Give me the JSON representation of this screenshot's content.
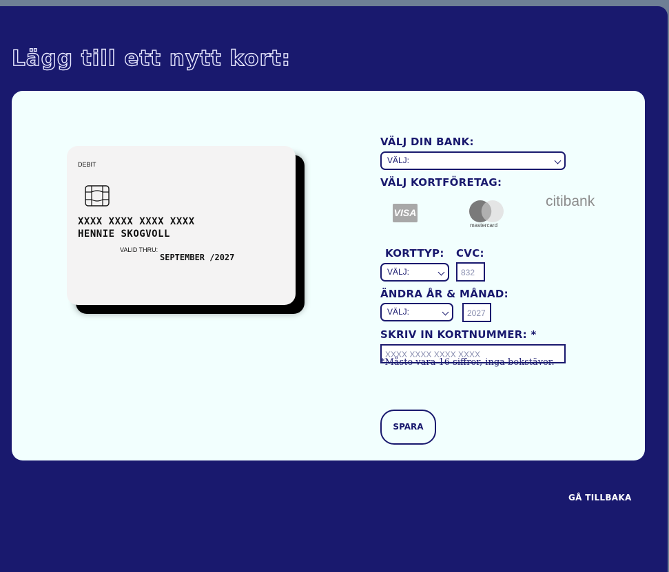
{
  "page": {
    "title": "Lägg till ett nytt kort:"
  },
  "card": {
    "type": "DEBIT",
    "number": "XXXX XXXX XXXX XXXX",
    "holder": "HENNIE SKOGVOLL",
    "valid_label": "VALID THRU:",
    "valid_date": "SEPTEMBER /2027"
  },
  "form": {
    "bank_label": "VÄLJ DIN BANK:",
    "bank_select": "VÄLJ:",
    "company_label": "VÄLJ KORTFÖRETAG:",
    "companies": [
      {
        "name": "VISA",
        "icon": "visa-logo"
      },
      {
        "name": "mastercard",
        "icon": "mastercard-logo"
      },
      {
        "name": "citibank",
        "icon": "citibank-logo"
      }
    ],
    "cardtype_label": "KORTTYP:",
    "cardtype_select": "VÄLJ:",
    "cvc_label": "CVC:",
    "cvc_placeholder": "832",
    "date_label": "ÄNDRA ÅR & MÅNAD:",
    "month_select": "VÄLJ:",
    "year_placeholder": "2027",
    "number_label": "SKRIV IN KORTNUMMER: *",
    "number_placeholder": "XXXX XXXX XXXX XXXX",
    "note": "*Måste vara 16 siffror, inga bokstäver.",
    "save_label": "SPARA"
  },
  "footer": {
    "back_label": "GÅ TILLBAKA"
  },
  "colors": {
    "primary": "#19196e",
    "panel": "#f2fffe",
    "card": "#f4f3f3"
  }
}
